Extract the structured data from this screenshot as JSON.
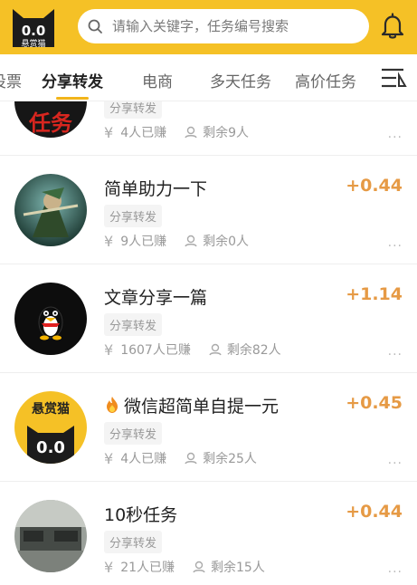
{
  "header": {
    "logo_title": "0.0",
    "logo_caption": "悬赏猫",
    "search_placeholder": "请输入关键字，任务编号搜索",
    "brand_color": "#f5c126"
  },
  "tabs": [
    {
      "label": "投票"
    },
    {
      "label": "分享转发",
      "active": true
    },
    {
      "label": "电商"
    },
    {
      "label": "多天任务"
    },
    {
      "label": "高价任务"
    }
  ],
  "tasks": [
    {
      "title": "",
      "price": "",
      "tag": "分享转发",
      "earned": "4人已赚",
      "remaining": "剩余9人",
      "avatar": "red-text-avatar",
      "avatar_text": "任务"
    },
    {
      "title": "简单助力一下",
      "price": "+0.44",
      "tag": "分享转发",
      "earned": "9人已赚",
      "remaining": "剩余0人",
      "avatar": "game-character-avatar"
    },
    {
      "title": "文章分享一篇",
      "price": "+1.14",
      "tag": "分享转发",
      "earned": "1607人已赚",
      "remaining": "剩余82人",
      "avatar": "penguin-avatar"
    },
    {
      "title": "微信超简单自提一元",
      "price": "+0.45",
      "tag": "分享转发",
      "earned": "4人已赚",
      "remaining": "剩余25人",
      "avatar": "cat-logo-avatar",
      "avatar_caption": "悬赏猫",
      "avatar_face": "0.0"
    },
    {
      "title": "10秒任务",
      "price": "+0.44",
      "tag": "分享转发",
      "earned": "21人已赚",
      "remaining": "剩余15人",
      "avatar": "photo-avatar"
    }
  ],
  "more_label": "···",
  "yen_symbol": "¥",
  "accent_price_color": "#e69a45"
}
